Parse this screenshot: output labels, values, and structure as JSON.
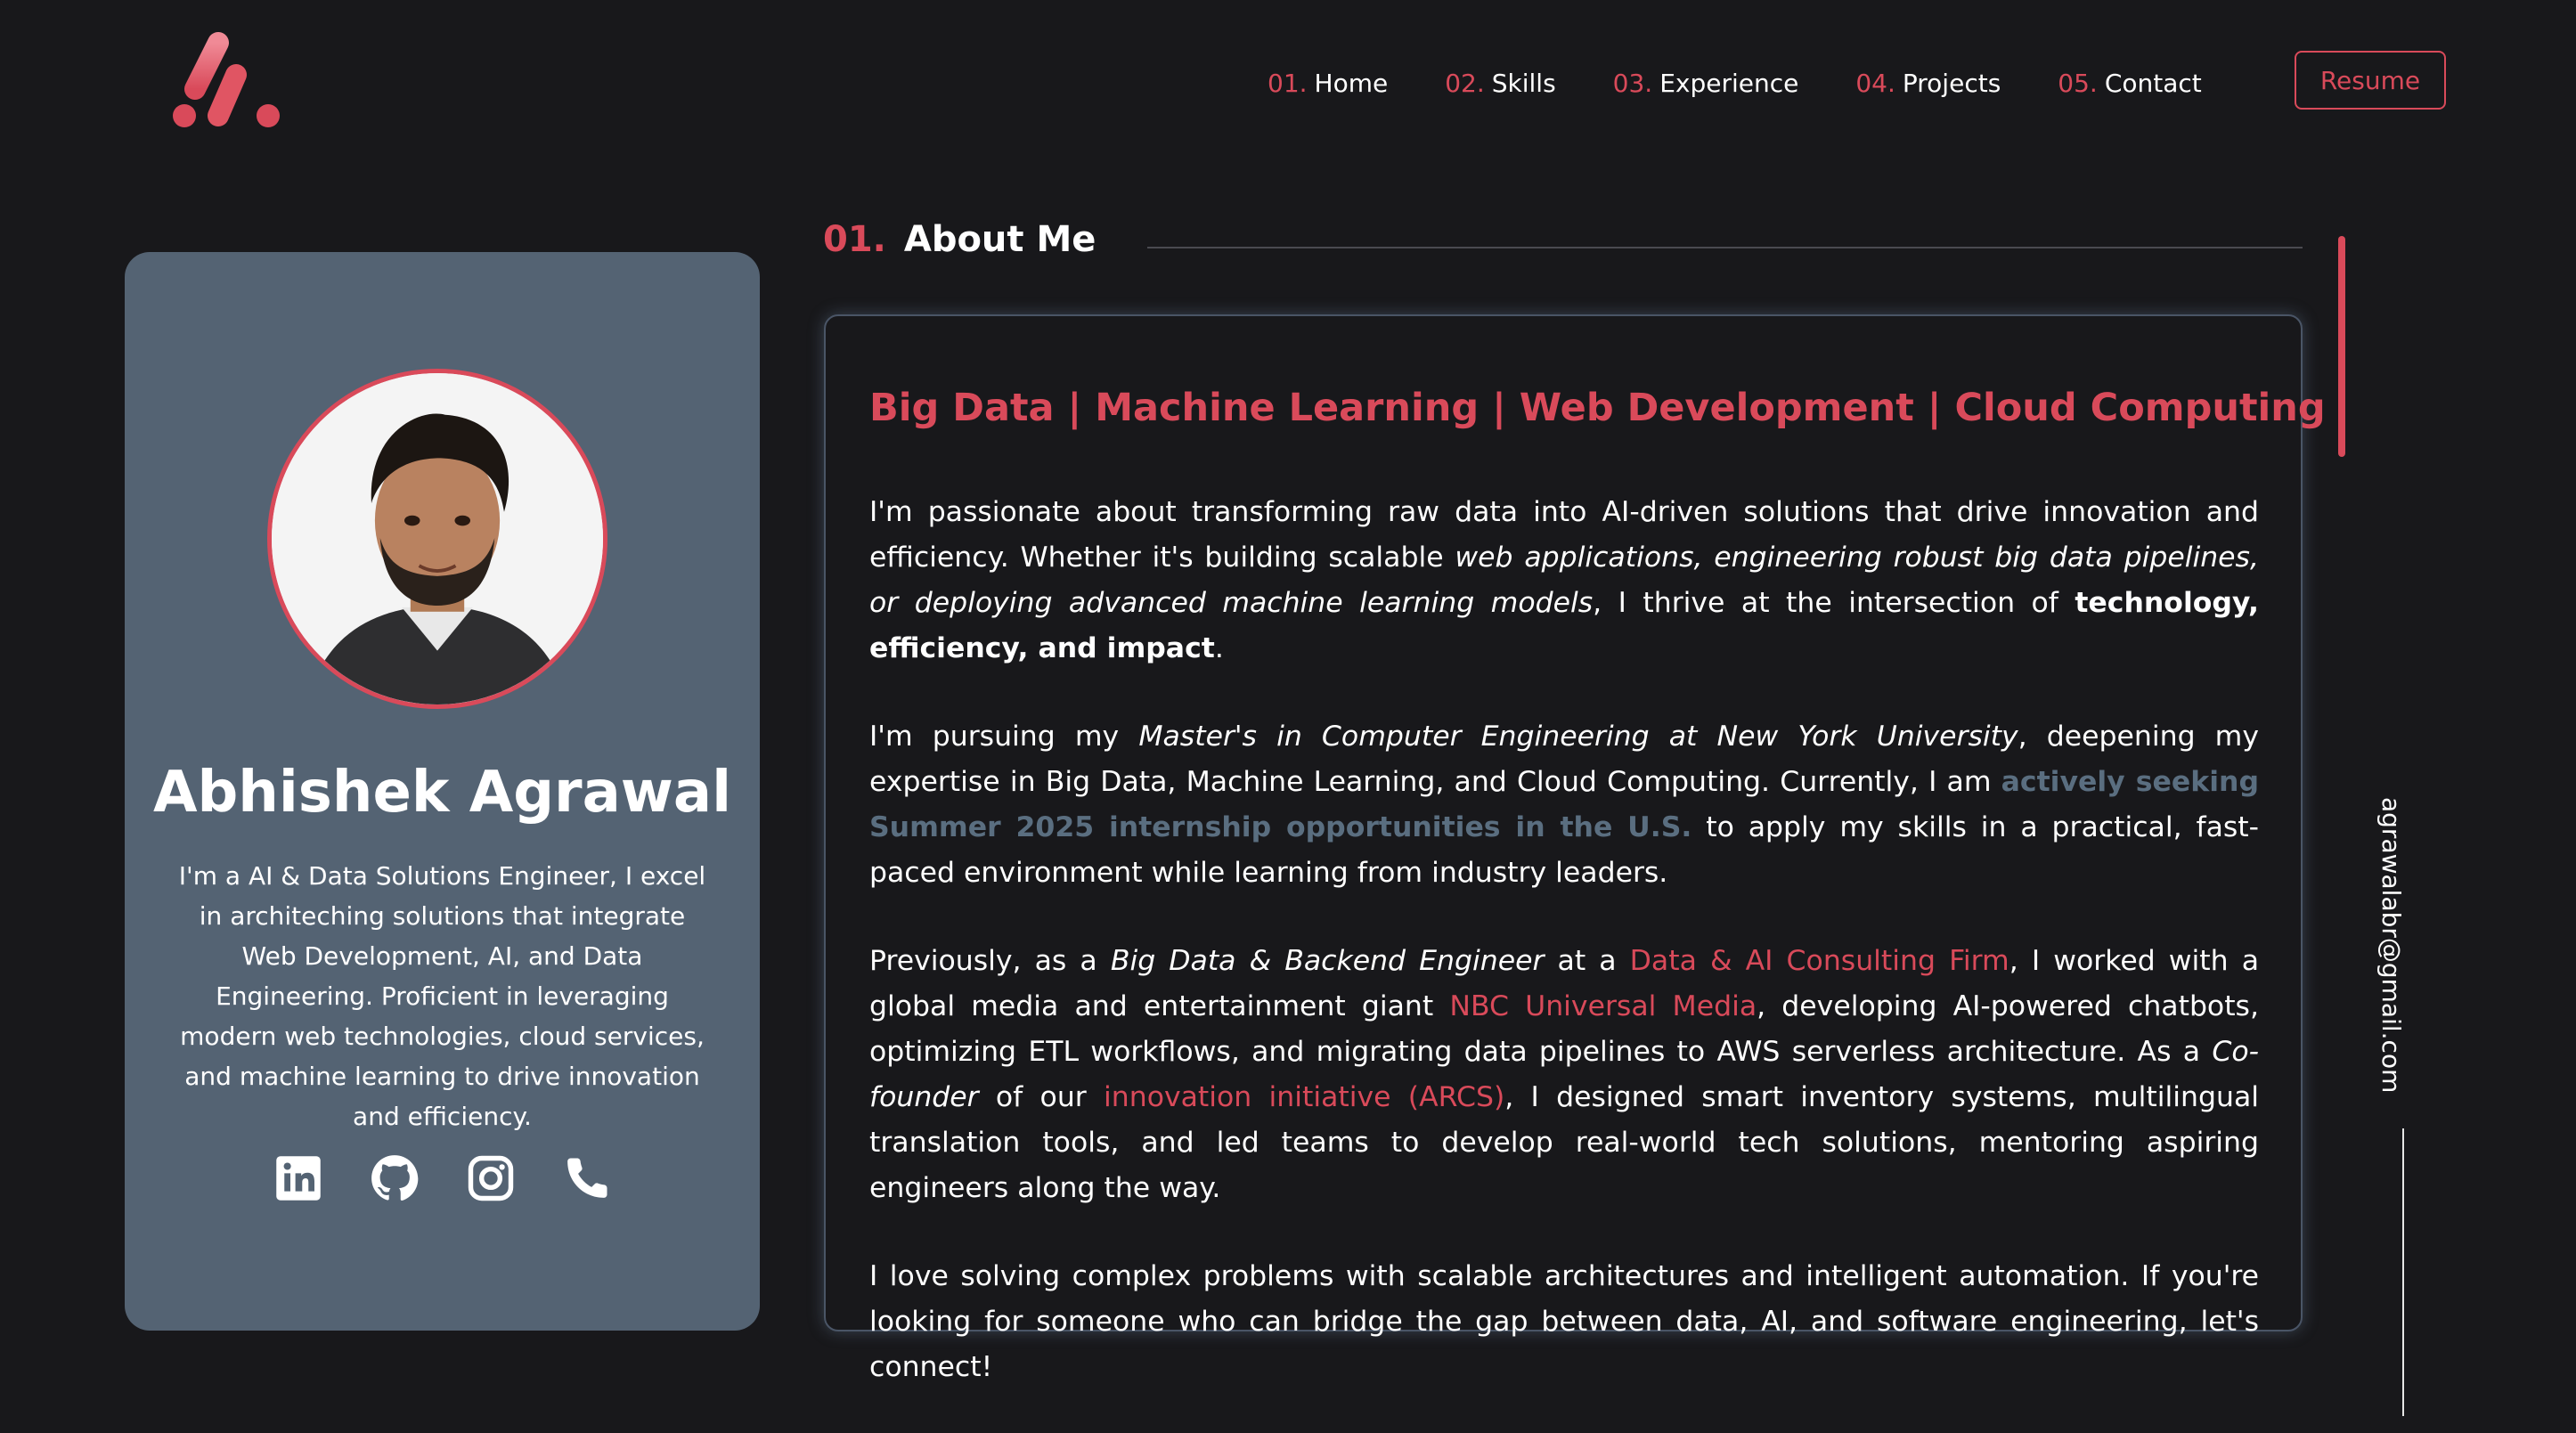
{
  "header": {
    "logo_icon": "brand-logo-icon",
    "nav": [
      {
        "num": "01.",
        "label": "Home"
      },
      {
        "num": "02.",
        "label": "Skills"
      },
      {
        "num": "03.",
        "label": "Experience"
      },
      {
        "num": "04.",
        "label": "Projects"
      },
      {
        "num": "05.",
        "label": "Contact"
      }
    ],
    "resume_label": "Resume"
  },
  "profile": {
    "name": "Abhishek Agrawal",
    "bio": "I'm a AI & Data Solutions Engineer, I excel in architeching solutions that integrate Web Development, AI, and Data Engineering. Proficient in leveraging modern web technologies, cloud services, and machine learning to drive innovation and efficiency.",
    "social_icons": [
      "linkedin-icon",
      "github-icon",
      "instagram-icon",
      "phone-icon"
    ]
  },
  "section": {
    "number": "01.",
    "title": "About Me"
  },
  "about": {
    "tagline": "Big Data | Machine Learning | Web Development | Cloud Computing",
    "p1": {
      "a": "I'm passionate about transforming raw data into AI-driven solutions that drive innovation and efficiency. Whether it's building scalable ",
      "em": "web applications, engineering robust big data pipelines, or deploying advanced machine learning models",
      "b": ", I thrive at the intersection of ",
      "strong": "technology, efficiency, and impact",
      "c": "."
    },
    "p2": {
      "a": "I'm pursuing my ",
      "em": "Master's in Computer Engineering at New York University",
      "b": ", deepening my expertise in Big Data, Machine Learning, and Cloud Computing. Currently, I am ",
      "highlight": "actively seeking Summer 2025 internship opportunities in the U.S.",
      "c": " to apply my skills in a practical, fast-paced environment while learning from industry leaders."
    },
    "p3": {
      "a": "Previously, as a ",
      "em1": "Big Data & Backend Engineer",
      "b": " at a ",
      "link1": "Data & AI Consulting Firm",
      "c": ", I worked with a global media and entertainment giant ",
      "link2": "NBC Universal Media",
      "d": ", developing AI-powered chatbots, optimizing ETL workflows, and migrating data pipelines to AWS serverless architecture. As a ",
      "em2": "Co-founder",
      "e": " of our ",
      "link3": "innovation initiative (ARCS)",
      "f": ", I designed smart inventory systems, multilingual translation tools, and led teams to develop real-world tech solutions, mentoring aspiring engineers along the way."
    },
    "p4": "I love solving complex problems with scalable architectures and intelligent automation. If you're looking for someone who can bridge the gap between data, AI, and software engineering, let's connect!"
  },
  "side": {
    "email": "agrawalabr@gmail.com"
  },
  "colors": {
    "accent": "#d94a5a",
    "background": "#18181b",
    "card": "#546373",
    "highlight": "#5a6e80"
  }
}
